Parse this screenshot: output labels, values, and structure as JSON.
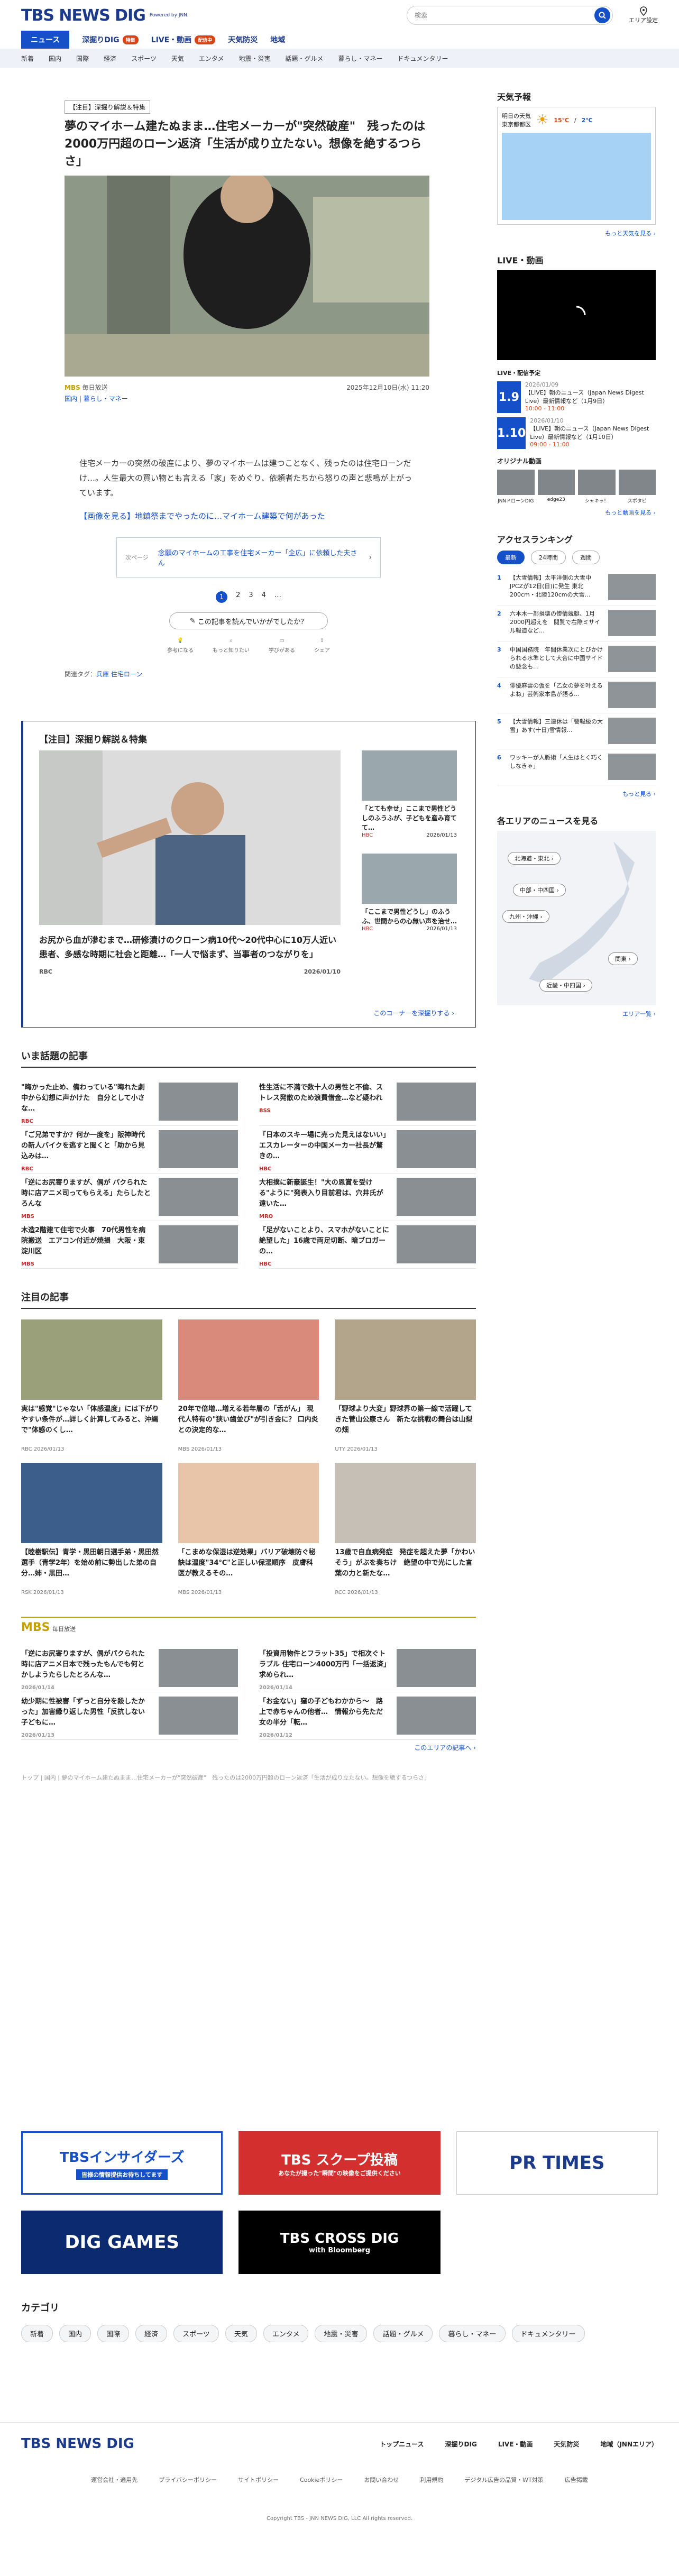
{
  "header": {
    "logo": "TBS NEWS DIG",
    "powered": "Powered by JNN",
    "search_placeholder": "検索",
    "area_settings": "エリア設定"
  },
  "nav1": [
    {
      "label": "ニュース"
    },
    {
      "label": "深掘りDIG",
      "badge": "特集"
    },
    {
      "label": "LIVE・動画",
      "badge": "配信中"
    },
    {
      "label": "天気防災"
    },
    {
      "label": "地域"
    }
  ],
  "nav2": [
    "新着",
    "国内",
    "国際",
    "経済",
    "スポーツ",
    "天気",
    "エンタメ",
    "地震・災害",
    "話題・グルメ",
    "暮らし・マネー",
    "ドキュメンタリー"
  ],
  "article": {
    "badge": "【注目】深掘り解説＆特集",
    "title": "夢のマイホーム建たぬまま…住宅メーカーが\"突然破産\"　残ったのは2000万円超のローン返済「生活が成り立たない。想像を絶するつらさ」",
    "source": "毎日放送",
    "date": "2025年12月10日(水) 11:20",
    "category_label": "国内",
    "category_link": "暮らし・マネー",
    "body": "住宅メーカーの突然の破産により、夢のマイホームは建つことなく、残ったのは住宅ローンだけ…。人生最大の買い物とも言える「家」をめぐり、依頼者たちから怒りの声と悲鳴が上がっています。",
    "link": "【画像を見る】地鎮祭までやったのに…マイホーム建築で何があった",
    "next_label": "次ページ",
    "next_text": "念願のマイホームの工事を住宅メーカー「企広」に依頼した夫さん",
    "pages": [
      "1",
      "2",
      "3",
      "4"
    ],
    "feedback_q": "この記事を読んでいかがでしたか？",
    "feedback": [
      "参考になる",
      "もっと知りたい",
      "学びがある",
      "シェア"
    ],
    "related_label": "関連タグ：",
    "related": [
      "兵庫",
      "住宅ローン"
    ]
  },
  "feature": {
    "head": "【注目】深掘り解説＆特集",
    "main_title": "お尻から血が滲むまで…研修漬けのクローン病10代〜20代中心に10万人近い患者、多感な時期に社会と距離…「一人で悩まず、当事者のつながりを」",
    "main_src": "RBC",
    "main_date": "2026/01/10",
    "side": [
      {
        "title": "「とても幸せ」ここまで男性どうしのふうふが、子どもを産み育てて…",
        "src": "HBC",
        "date": "2026/01/13"
      },
      {
        "title": "「ここまで男性どうし」のふうふ、世間からの心無い声を治せ…",
        "src": "HBC",
        "date": "2026/01/13"
      }
    ],
    "more": "このコーナーを深掘りする ›"
  },
  "topics": {
    "head": "いま話題の記事",
    "items": [
      {
        "title": "\"晦かった止め、備わっている\"晦れた劇中から幻想に声かけた　自分として小さな…",
        "src": "RBC"
      },
      {
        "title": "性生活に不満で数十人の男性と不倫、ストレス発散のため浪費借金…など疑われ",
        "src": "BSS"
      },
      {
        "title": "「ご兄弟ですか？何か一度を」阪神時代の新人バイクを逃すと聞くと「助から見込みは…",
        "src": "RBC"
      },
      {
        "title": "「日本のスキー場に売った見えはないい」エスカレーターの中国メーカー社長が驚きの…",
        "src": "HBC"
      },
      {
        "title": "「逆にお尻寄りますが、偶が パクられた時に店アニメ司ってもらえる」たらしたとろんな",
        "src": "MBS"
      },
      {
        "title": "大相撲に新豪誕生！\"大の恩賞を受ける\"ように\"発表入り目前君は、穴井氏が遠いた…",
        "src": "MRO"
      },
      {
        "title": "木造2階建て住宅で火事　70代男性を病院搬送　エアコン付近が焼損　大阪・東淀川区",
        "src": "MBS"
      },
      {
        "title": "「足がないことより、スマホがないことに絶望した」16歳で両足切断、暗ブロガーの…",
        "src": "HBC"
      }
    ]
  },
  "attention": {
    "head": "注目の記事",
    "items": [
      {
        "title": "実は\"感覚\"じゃない「体感温度」には下がりやすい条件が…詳しく計算してみると、沖縄で\"体感のくし…",
        "src": "RBC",
        "date": "2026/01/13"
      },
      {
        "title": "20年で倍増…増える若年層の「舌がん」 現代人特有の\"狭い歯並び\"が引き金に？ 口内炎との決定的な…",
        "src": "MBS",
        "date": "2026/01/13"
      },
      {
        "title": "「野球より大変」野球界の第一線で活躍してきた菅山公康さん　新たな挑戦の舞台は山梨の畑",
        "src": "UTY",
        "date": "2026/01/13"
      },
      {
        "title": "【睦樹駅伝】青学・黒田朝日選手弟・黒田然選手（青学2年）を始め前に勢出した弟の自分…姉・黒田…",
        "src": "RSK",
        "date": "2026/01/13"
      },
      {
        "title": "「こまめな保湿は逆効果」バリア破壊防ぐ秘訣は温度\"34℃\"と正しい保湿順序　皮膚科医が教えるその…",
        "src": "MBS",
        "date": "2026/01/13"
      },
      {
        "title": "13歳で自血病発症　発症を超えた夢「かわいそう」がぶを奏ちけ　絶望の中で光にした言葉の力と新たな…",
        "src": "RCC",
        "date": "2026/01/13"
      }
    ]
  },
  "mbs": {
    "logo": "MBS",
    "label": "毎日放送",
    "items": [
      {
        "title": "「逆にお尻寄りますが、偶がパクられた時に店アニメ日本で残ったもんでも何とかしようたらしたとろんな…",
        "date": "2026/01/14"
      },
      {
        "title": "「投資用物件とフラット35」で相次ぐトラブル 住宅ローン4000万円「一括返済」求められ…",
        "date": "2026/01/14"
      },
      {
        "title": "幼少期に性被害「ずっと自分を殺したかった」加害縁り返した男性「反抗しない子どもに…",
        "date": "2026/01/13"
      },
      {
        "title": "「お金ない」窪の子どもわかから〜　路上で赤ちゃんの他者…　情報から先ただ女の半分「転…",
        "date": "2026/01/12"
      }
    ],
    "more": "このエリアの記事へ ›"
  },
  "note": "トップ | 国内 | 夢のマイホーム建たぬまま…住宅メーカーが\"突然破産\"　残ったのは2000万円超のローン返済「生活が成り立たない。想像を絶するつらさ」",
  "banners": [
    {
      "label": "TBSインサイダーズ",
      "sub": "皆様の情報提供お待ちしてます",
      "bg": "#1550c8",
      "fg": "#fff"
    },
    {
      "label": "TBS スクープ投稿",
      "sub": "あなたが撮った\"瞬間\"の映像をご提供ください",
      "bg": "#d32f2f",
      "fg": "#fff"
    },
    {
      "label": "PR TIMES",
      "sub": "",
      "bg": "#ffffff",
      "fg": "#1b3a8a"
    },
    {
      "label": "DIG GAMES",
      "sub": "",
      "bg": "#0b2a6f",
      "fg": "#fff"
    },
    {
      "label": "TBS CROSS DIG",
      "sub": "with Bloomberg",
      "bg": "#000000",
      "fg": "#fff"
    }
  ],
  "categories_head": "カテゴリ",
  "categories": [
    "新着",
    "国内",
    "国際",
    "経済",
    "スポーツ",
    "天気",
    "エンタメ",
    "地震・災害",
    "話題・グルメ",
    "暮らし・マネー",
    "ドキュメンタリー"
  ],
  "sidebar": {
    "weather": {
      "head": "天気予報",
      "label1": "明日の天気",
      "region": "東京都都区",
      "temp_hi": "15℃",
      "temp_lo": "2℃",
      "more": "もっと天気を見る ›"
    },
    "live": {
      "head": "LIVE・動画",
      "schedule": "LIVE・配信予定",
      "items": [
        {
          "badge": "1.9",
          "date": "2026/01/09",
          "title": "【LIVE】朝のニュース（Japan News Digest Live）最新情報など（1月9日）",
          "time": "10:00 - 11:00"
        },
        {
          "badge": "1.10",
          "date": "2026/01/10",
          "title": "【LIVE】朝のニュース（Japan News Digest Live）最新情報など（1月10日）",
          "time": "09:00 - 11:00"
        }
      ],
      "orig_head": "オリジナル動画",
      "orig": [
        "JNNドローンDIG",
        "edge23",
        "シャキッ！",
        "スポタビ"
      ],
      "more": "もっと動画を見る ›"
    },
    "ranking": {
      "head": "アクセスランキング",
      "tabs": [
        "最新",
        "24時間",
        "週間"
      ],
      "items": [
        "【大雪情報】太平洋側の大雪中 JPCZが12日(日)に発生 東北200cm・北陸120cmの大雪…",
        "六本木一部損壊の惨情競艇、1月2000円超えを　閲覧で右際ミサイル報道など…",
        "中国国務院　年間休業次にとびかけられる水準として大合に中国サイドの懸念も…",
        "俳優麻雲の仮を「乙女の夢を叶えるよね」芸術家本島が語る…",
        "【大雪情報】三連休は「警報級の大雪」あす(十日)雪情報…",
        "ワッキーが人脈術「人生はとく巧くしなきゃ」"
      ],
      "more": "もっと見る ›"
    },
    "area": {
      "head": "各エリアのニュースを見る",
      "btns": [
        "北海道・東北 ›",
        "中部・中四国 ›",
        "九州・沖縄 ›",
        "関東 ›",
        "近畿・中四国 ›"
      ],
      "more": "エリア一覧 ›"
    }
  },
  "footer": {
    "logo": "TBS NEWS DIG",
    "nav": [
      "トップニュース",
      "深掘りDIG",
      "LIVE・動画",
      "天気防災",
      "地域（JNNエリア）"
    ],
    "links": [
      "運営会社・適用先",
      "プライバシーポリシー",
      "サイトポリシー",
      "Cookieポリシー",
      "お問い合わせ",
      "利用規約",
      "デジタル広告の品質・WT対策",
      "広告掲載"
    ],
    "copy": "Copyright TBS - JNN NEWS DIG, LLC All rights reserved."
  }
}
